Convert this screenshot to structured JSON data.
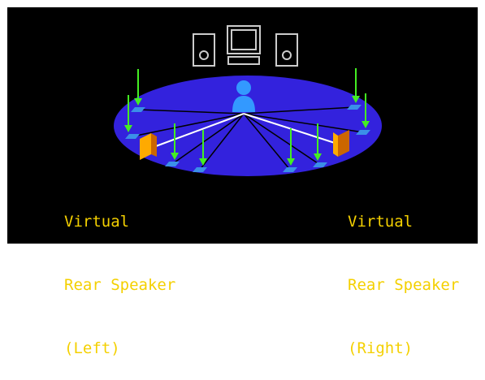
{
  "colors": {
    "background": "#000000",
    "floor": "#3322dd",
    "arrow": "#44ee22",
    "label": "#f4d000",
    "listener": "#3399ff",
    "hardware_outline": "#cccccc",
    "speaker_front": "#ffaa00",
    "speaker_side": "#cc6600",
    "beam": "#ffffff",
    "reflection_line": "#000000"
  },
  "labels": {
    "left": {
      "line1": "Virtual",
      "line2": "Rear Speaker",
      "line3": "(Left)"
    },
    "right": {
      "line1": "Virtual",
      "line2": "Rear Speaker",
      "line3": "(Right)"
    }
  },
  "icons": {
    "monitor": "monitor-icon",
    "left_speaker": "front-speaker-left-icon",
    "right_speaker": "front-speaker-right-icon",
    "listener": "listener-icon",
    "virtual_speaker": "virtual-speaker-icon",
    "arrow": "down-arrow-icon"
  }
}
